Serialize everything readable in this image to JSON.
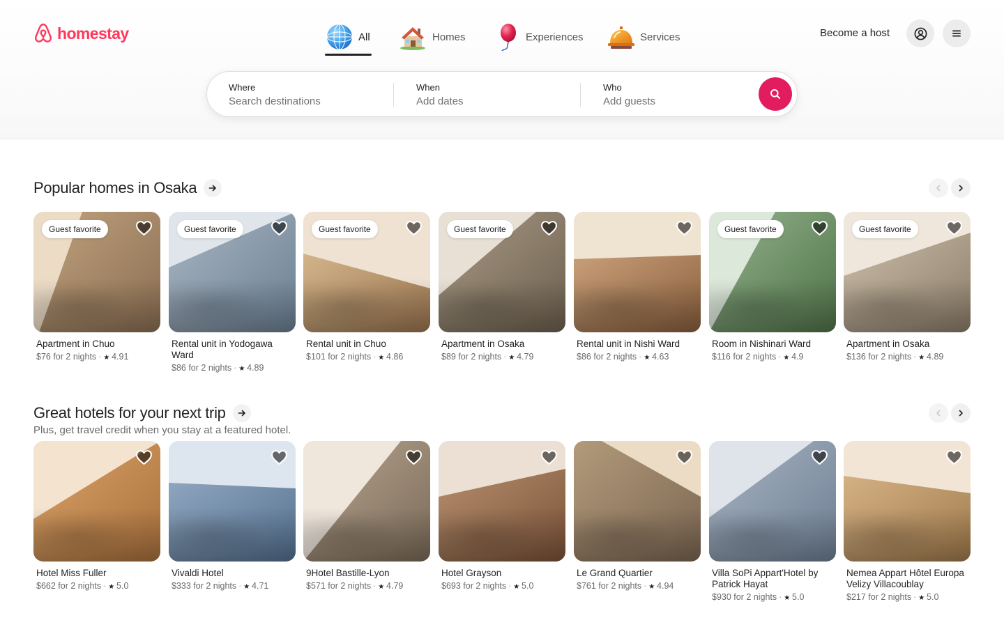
{
  "brand": {
    "name": "homestay",
    "color": "#FF385C",
    "icon": "homestay-logo-icon"
  },
  "nav": {
    "tabs": [
      {
        "label": "All",
        "icon": "globe-icon",
        "active": true
      },
      {
        "label": "Homes",
        "icon": "house-icon",
        "active": false
      },
      {
        "label": "Experiences",
        "icon": "balloon-icon",
        "active": false
      },
      {
        "label": "Services",
        "icon": "service-bell-icon",
        "active": false
      }
    ],
    "host_link": "Become a host",
    "profile_icon": "user-circle-icon",
    "menu_icon": "hamburger-menu-icon"
  },
  "search": {
    "where": {
      "label": "Where",
      "placeholder": "Search destinations"
    },
    "when": {
      "label": "When",
      "placeholder": "Add dates"
    },
    "who": {
      "label": "Who",
      "placeholder": "Add guests"
    },
    "button_icon": "search-icon",
    "button_color": "#E31C5F"
  },
  "sections": [
    {
      "title": "Popular homes in Osaka",
      "subtitle": "",
      "listings": [
        {
          "title": "Apartment in Chuo",
          "price": "$76 for 2 nights",
          "rating": "4.91",
          "badge": "Guest favorite"
        },
        {
          "title": "Rental unit in Yodogawa Ward",
          "price": "$86 for 2 nights",
          "rating": "4.89",
          "badge": "Guest favorite"
        },
        {
          "title": "Rental unit in Chuo",
          "price": "$101 for 2 nights",
          "rating": "4.86",
          "badge": "Guest favorite"
        },
        {
          "title": "Apartment in Osaka",
          "price": "$89 for 2 nights",
          "rating": "4.79",
          "badge": "Guest favorite"
        },
        {
          "title": "Rental unit in Nishi Ward",
          "price": "$86 for 2 nights",
          "rating": "4.63",
          "badge": ""
        },
        {
          "title": "Room in Nishinari Ward",
          "price": "$116 for 2 nights",
          "rating": "4.9",
          "badge": "Guest favorite"
        },
        {
          "title": "Apartment in Osaka",
          "price": "$136 for 2 nights",
          "rating": "4.89",
          "badge": "Guest favorite"
        }
      ]
    },
    {
      "title": "Great hotels for your next trip",
      "subtitle": "Plus, get travel credit when you stay at a featured hotel.",
      "listings": [
        {
          "title": "Hotel Miss Fuller",
          "price": "$662 for 2 nights",
          "rating": "5.0",
          "badge": ""
        },
        {
          "title": "Vivaldi Hotel",
          "price": "$333 for 2 nights",
          "rating": "4.71",
          "badge": ""
        },
        {
          "title": "9Hotel Bastille-Lyon",
          "price": "$571 for 2 nights",
          "rating": "4.79",
          "badge": ""
        },
        {
          "title": "Hotel Grayson",
          "price": "$693 for 2 nights",
          "rating": "5.0",
          "badge": ""
        },
        {
          "title": "Le Grand Quartier",
          "price": "$761 for 2 nights",
          "rating": "4.94",
          "badge": ""
        },
        {
          "title": "Villa SoPi Appart'Hotel by Patrick Hayat",
          "price": "$930 for 2 nights",
          "rating": "5.0",
          "badge": ""
        },
        {
          "title": "Nemea Appart Hôtel Europa Velizy Villacoublay",
          "price": "$217 for 2 nights",
          "rating": "5.0",
          "badge": ""
        }
      ]
    }
  ]
}
